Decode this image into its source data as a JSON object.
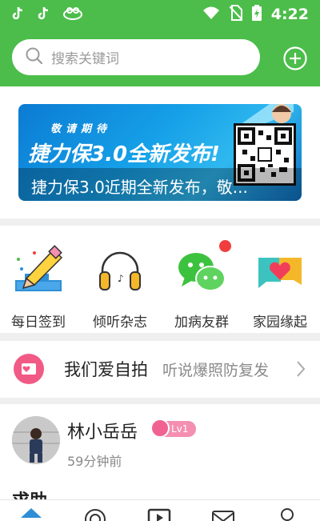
{
  "status_bar": {
    "time": "4:22"
  },
  "search": {
    "placeholder": "搜索关键词"
  },
  "banner": {
    "kicker": "敬请期待",
    "headline": "捷力保3.0全新发布!",
    "caption": "捷力保3.0近期全新发布，敬..."
  },
  "quick_actions": [
    {
      "label": "每日签到",
      "icon": "pencil-checkin-icon"
    },
    {
      "label": "倾听杂志",
      "icon": "headphones-icon"
    },
    {
      "label": "加病友群",
      "icon": "wechat-chat-icon",
      "has_dot": true
    },
    {
      "label": "家园缘起",
      "icon": "heart-chat-icon"
    }
  ],
  "topic": {
    "title": "我们爱自拍",
    "subtitle": "听说爆照防复发"
  },
  "post": {
    "username": "林小岳岳",
    "level": "Lv1",
    "time": "59分钟前",
    "title": "求助"
  },
  "colors": {
    "brand_green": "#4cbd4a",
    "red_dot": "#f13d3d",
    "badge_pink": "#f48fb1"
  },
  "tab_icons": [
    "home-icon",
    "discover-icon",
    "video-icon",
    "message-icon",
    "profile-icon"
  ]
}
